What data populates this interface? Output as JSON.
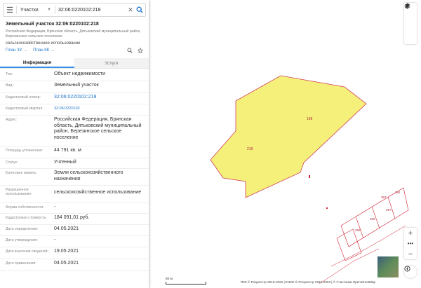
{
  "search": {
    "category": "Участки",
    "query": "32:06:0220102:218"
  },
  "parcel": {
    "title": "Земельный участок 32:06:0220102:218",
    "address": "Российская Федерация, Брянская область, Дятьковский муниципальный район, Березинское сельское поселение",
    "use": "сельскохозяйственное использование",
    "link_prev": "План ЗУ →",
    "link_next": "План КК →"
  },
  "tabs": [
    {
      "label": "Информация",
      "active": true
    },
    {
      "label": "Услуги",
      "active": false
    }
  ],
  "rows": [
    {
      "label": "Тип:",
      "value": "Объект недвижимости"
    },
    {
      "label": "Вид:",
      "value": "Земельный участок"
    },
    {
      "label": "Кадастровый номер:",
      "value": "32:06:0220102:218"
    },
    {
      "label": "Кадастровый квартал:",
      "value": "32:06:0220102"
    },
    {
      "label": "Адрес:",
      "value": "Российская Федерация, Брянская область, Дятьковский муниципальный район, Березинское сельское поселение"
    },
    {
      "label": "Площадь уточненная:",
      "value": "44 791 кв. м"
    },
    {
      "label": "Статус:",
      "value": "Учтенный"
    },
    {
      "label": "Категория земель:",
      "value": "Земли сельскохозяйственного назначения"
    },
    {
      "label": "Разрешенное использование:",
      "value": "сельскохозяйственное использование"
    },
    {
      "label": "Форма собственности:",
      "value": "-"
    },
    {
      "label": "Кадастровая стоимость:",
      "value": "184 091,01 руб."
    },
    {
      "label": "Дата определения:",
      "value": "04.05.2021"
    },
    {
      "label": "Дата утверждения:",
      "value": "-"
    },
    {
      "label": "Дата внесения сведений:",
      "value": "19.05.2021"
    },
    {
      "label": "Дата применения:",
      "value": "04.05.2021"
    }
  ],
  "map": {
    "parcel_labels": [
      "218",
      "198"
    ],
    "neighbour_labels": [
      "364",
      "367",
      "367",
      "365",
      "366"
    ],
    "scale": "60 м",
    "attribution": "ПКК © Росреестр 2010-2022 | ЕЭКО © Росреестр 2010-2022 | © Участники OpenStreetMap",
    "colors": {
      "parcel_fill": "#f5f07a",
      "parcel_stroke": "#d0405a",
      "accent": "#1a73c8"
    }
  }
}
